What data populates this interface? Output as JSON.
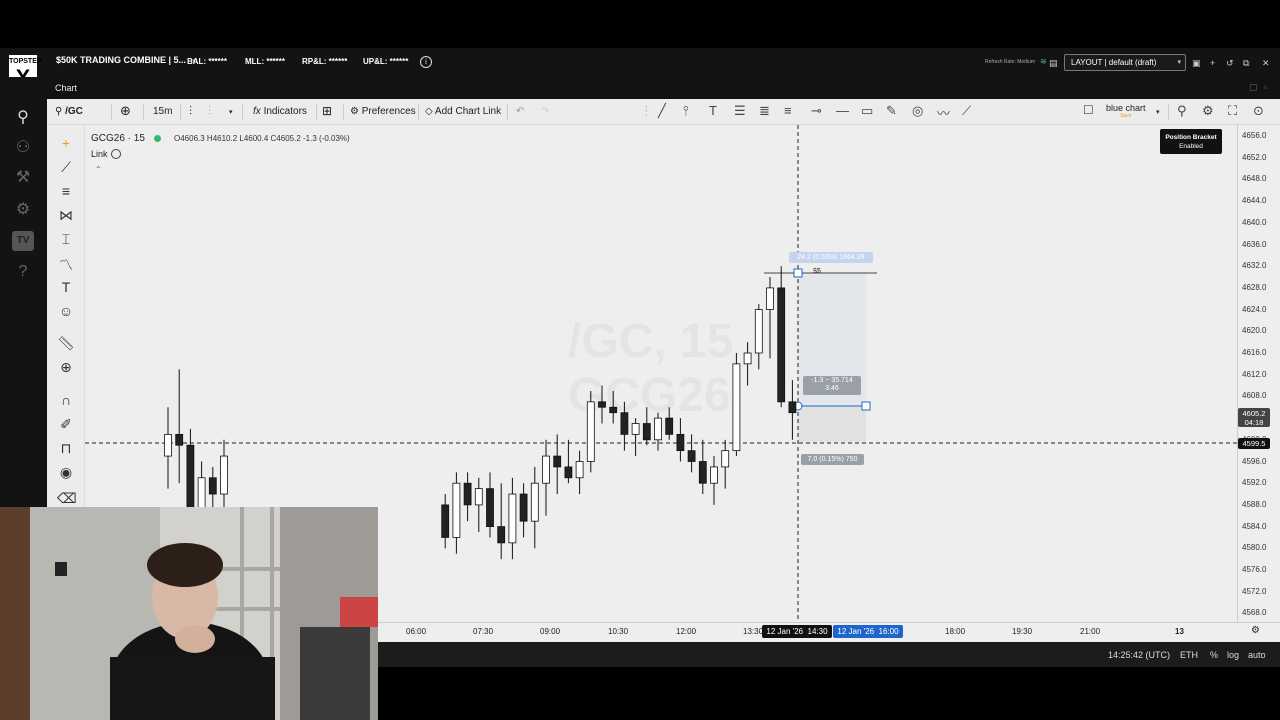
{
  "brand": {
    "line1": "TOPSTEP",
    "mark": "X"
  },
  "topbar": {
    "account": "$50K TRADING COMBINE | 5...",
    "metrics": [
      {
        "label": "BAL: ******"
      },
      {
        "label": "MLL: ******"
      },
      {
        "label": "RP&L: ******"
      },
      {
        "label": "UP&L: ******"
      }
    ],
    "refresh": "Refresh Rate: Medium",
    "layout": "LAYOUT | default (draft)"
  },
  "chart_tab": {
    "label": "Chart"
  },
  "toolbar": {
    "symbol": "/GC",
    "interval": "15m",
    "indicators": "Indicators",
    "preferences": "Preferences",
    "add_chart_link": "Add Chart Link",
    "theme": "blue chart",
    "theme_sub": "Save"
  },
  "legend": {
    "symbol": "GCG26 · 15",
    "ohlc": "O4606.3 H4610.2 L4600.4 C4605.2 -1.3 (-0.03%)",
    "link": "Link",
    "watermark_1": "/GC, 15",
    "watermark_2": "GCG26"
  },
  "position_bracket": {
    "line1": "Position Bracket",
    "line2": "Enabled"
  },
  "bracket": {
    "top_label": "24.2 (0.53%) 1664.28",
    "tp_tag": "$$",
    "mid_label_1": "-1.3 − 35.714",
    "mid_label_2": "3.46",
    "bottom_label": "7.0 (0.15%) 750"
  },
  "price_axis": [
    "4656.0",
    "4652.0",
    "4648.0",
    "4644.0",
    "4640.0",
    "4636.0",
    "4632.0",
    "4628.0",
    "4624.0",
    "4620.0",
    "4616.0",
    "4612.0",
    "4608.0",
    "4600.0",
    "4596.0",
    "4592.0",
    "4588.0",
    "4584.0",
    "4580.0",
    "4576.0",
    "4572.0",
    "4568.0"
  ],
  "last_price": {
    "price": "4605.2",
    "countdown": "04:18"
  },
  "cursor_price": "4599.5",
  "time_axis": [
    "06:00",
    "07:30",
    "09:00",
    "10:30",
    "12:00",
    "13:30",
    "18:00",
    "19:30",
    "21:00",
    "13"
  ],
  "time_cursor": {
    "left": "12 Jan '26",
    "mid": "14:30",
    "right": "12 Jan '26",
    "right2": "16:00"
  },
  "bottom": {
    "clock": "14:25:42 (UTC)",
    "session": "ETH",
    "pct": "%",
    "log": "log",
    "auto": "auto"
  },
  "chart_data": {
    "type": "candlestick",
    "symbol": "GCG26",
    "interval": "15m",
    "ylim": [
      4566,
      4658
    ],
    "candles": [
      {
        "o": 4597,
        "h": 4606,
        "l": 4591,
        "c": 4601
      },
      {
        "o": 4601,
        "h": 4613,
        "l": 4592,
        "c": 4599
      },
      {
        "o": 4599,
        "h": 4602,
        "l": 4580,
        "c": 4584
      },
      {
        "o": 4584,
        "h": 4596,
        "l": 4578,
        "c": 4593
      },
      {
        "o": 4593,
        "h": 4595,
        "l": 4586,
        "c": 4590
      },
      {
        "o": 4590,
        "h": 4600,
        "l": 4587,
        "c": 4597
      },
      {
        "o": 4588,
        "h": 4590,
        "l": 4580,
        "c": 4582
      },
      {
        "o": 4582,
        "h": 4594,
        "l": 4579,
        "c": 4592
      },
      {
        "o": 4592,
        "h": 4594,
        "l": 4585,
        "c": 4588
      },
      {
        "o": 4588,
        "h": 4593,
        "l": 4583,
        "c": 4591
      },
      {
        "o": 4591,
        "h": 4594,
        "l": 4582,
        "c": 4584
      },
      {
        "o": 4584,
        "h": 4592,
        "l": 4578,
        "c": 4581
      },
      {
        "o": 4581,
        "h": 4593,
        "l": 4578,
        "c": 4590
      },
      {
        "o": 4590,
        "h": 4592,
        "l": 4582,
        "c": 4585
      },
      {
        "o": 4585,
        "h": 4595,
        "l": 4580,
        "c": 4592
      },
      {
        "o": 4592,
        "h": 4600,
        "l": 4586,
        "c": 4597
      },
      {
        "o": 4597,
        "h": 4601,
        "l": 4590,
        "c": 4595
      },
      {
        "o": 4595,
        "h": 4600,
        "l": 4592,
        "c": 4593
      },
      {
        "o": 4593,
        "h": 4598,
        "l": 4590,
        "c": 4596
      },
      {
        "o": 4596,
        "h": 4609,
        "l": 4594,
        "c": 4607
      },
      {
        "o": 4607,
        "h": 4610,
        "l": 4603,
        "c": 4606
      },
      {
        "o": 4606,
        "h": 4609,
        "l": 4603,
        "c": 4605
      },
      {
        "o": 4605,
        "h": 4607,
        "l": 4598,
        "c": 4601
      },
      {
        "o": 4601,
        "h": 4604,
        "l": 4597,
        "c": 4603
      },
      {
        "o": 4603,
        "h": 4606,
        "l": 4599,
        "c": 4600
      },
      {
        "o": 4600,
        "h": 4605,
        "l": 4598,
        "c": 4604
      },
      {
        "o": 4604,
        "h": 4606,
        "l": 4600,
        "c": 4601
      },
      {
        "o": 4601,
        "h": 4604,
        "l": 4596,
        "c": 4598
      },
      {
        "o": 4598,
        "h": 4601,
        "l": 4594,
        "c": 4596
      },
      {
        "o": 4596,
        "h": 4600,
        "l": 4590,
        "c": 4592
      },
      {
        "o": 4592,
        "h": 4597,
        "l": 4588,
        "c": 4595
      },
      {
        "o": 4595,
        "h": 4600,
        "l": 4591,
        "c": 4598
      },
      {
        "o": 4598,
        "h": 4616,
        "l": 4597,
        "c": 4614
      },
      {
        "o": 4614,
        "h": 4618,
        "l": 4610,
        "c": 4616
      },
      {
        "o": 4616,
        "h": 4625,
        "l": 4613,
        "c": 4624
      },
      {
        "o": 4624,
        "h": 4630,
        "l": 4615,
        "c": 4628
      },
      {
        "o": 4628,
        "h": 4632,
        "l": 4606,
        "c": 4607
      },
      {
        "o": 4607,
        "h": 4611,
        "l": 4600,
        "c": 4605
      }
    ]
  }
}
